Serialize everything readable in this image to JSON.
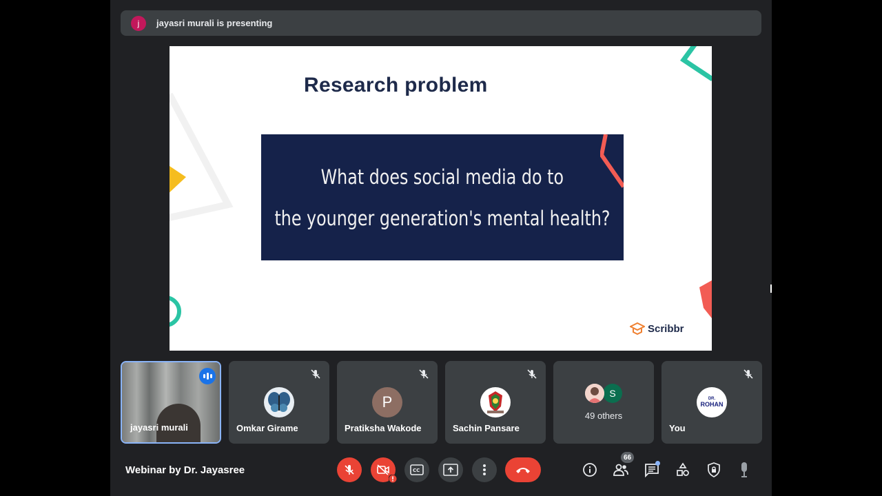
{
  "presenting": {
    "avatar_initial": "j",
    "text": "jayasri murali is presenting"
  },
  "slide": {
    "title": "Research problem",
    "question_line1": "What does social media do to",
    "question_line2": "the younger generation's mental health?",
    "brand": "Scribbr"
  },
  "participants": [
    {
      "name": "jayasri murali",
      "muted": false,
      "speaking": true,
      "type": "video"
    },
    {
      "name": "Omkar Girame",
      "muted": true,
      "type": "image",
      "avatar_icon": "butterfly-icon"
    },
    {
      "name": "Pratiksha Wakode",
      "muted": true,
      "type": "initial",
      "initial": "P",
      "color": "#8d6e63"
    },
    {
      "name": "Sachin Pansare",
      "muted": true,
      "type": "image",
      "avatar_icon": "emblem-icon"
    },
    {
      "name": "49 others",
      "type": "others",
      "avatar_initial": "S",
      "avatar_color": "#0b6e4f"
    },
    {
      "name": "You",
      "muted": true,
      "type": "image",
      "avatar_icon": "dr-rohan-logo-icon",
      "avatar_text_top": "DR.",
      "avatar_text_main": "ROHAN"
    }
  ],
  "meeting": {
    "title": "Webinar by Dr. Jayasree",
    "participant_count": "66"
  },
  "controls": {
    "mic": "mic-off-icon",
    "camera": "camera-off-icon",
    "captions": "captions-icon",
    "present": "present-screen-icon",
    "more": "more-options-icon",
    "end_call": "end-call-icon"
  },
  "colors": {
    "background": "#202124",
    "tile": "#3c4043",
    "danger": "#ea4335",
    "accent": "#8ab4f8",
    "slide_navy": "#15224a"
  }
}
